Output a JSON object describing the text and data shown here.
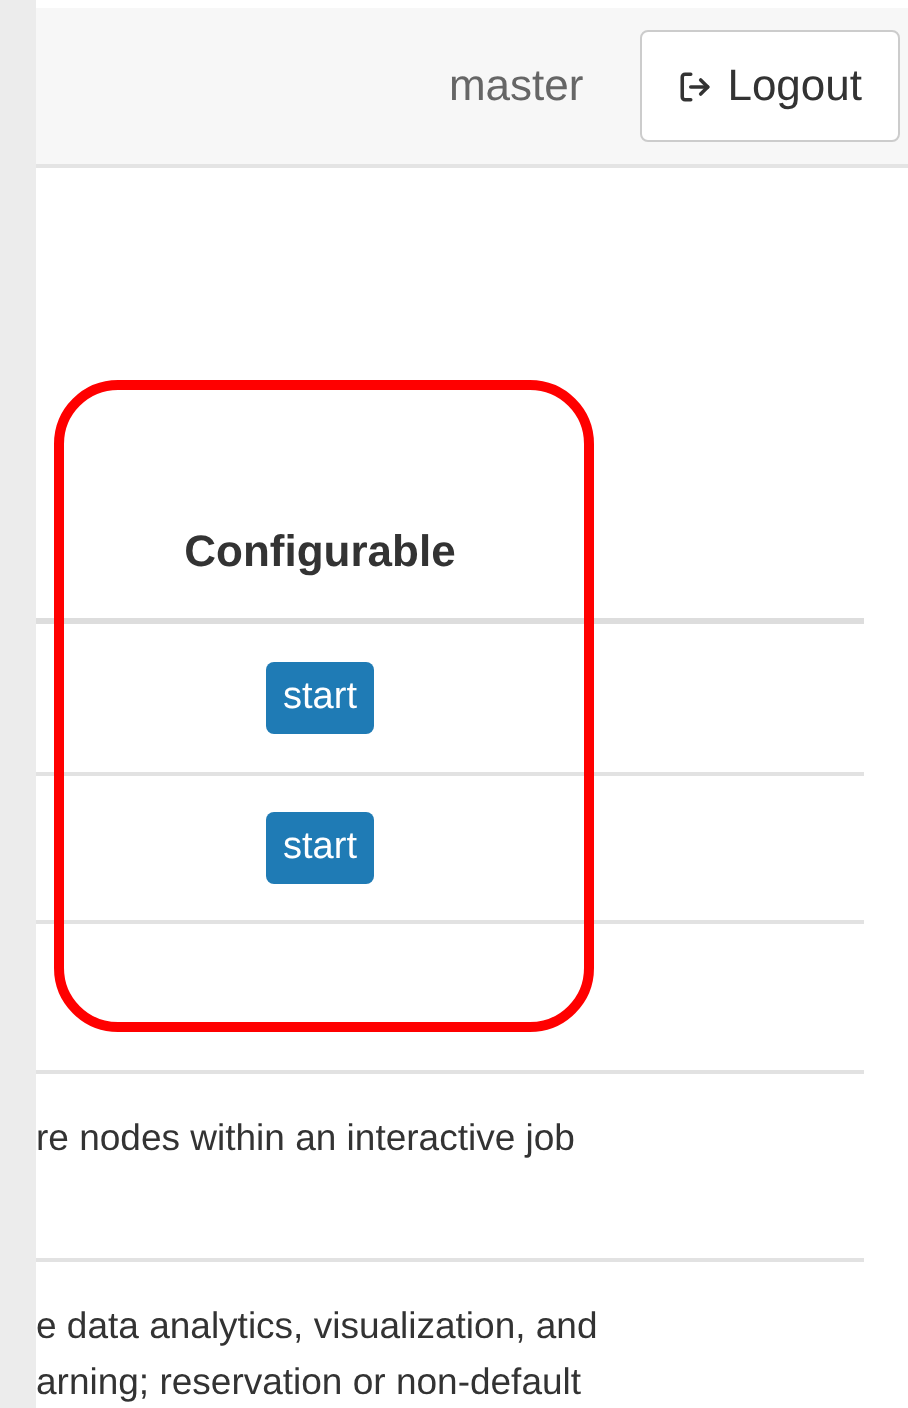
{
  "navbar": {
    "user": "master",
    "logout_button": {
      "label": "Logout"
    }
  },
  "table": {
    "header": "Configurable",
    "rows": [
      {
        "kind": "button",
        "label": "start"
      },
      {
        "kind": "button",
        "label": "start"
      },
      {
        "kind": "empty"
      },
      {
        "kind": "text",
        "text": "re nodes within an interactive job"
      },
      {
        "kind": "text",
        "text": "e data analytics, visualization, and\narning; reservation or non-default"
      }
    ]
  },
  "highlight": {
    "color": "#ff0000"
  }
}
